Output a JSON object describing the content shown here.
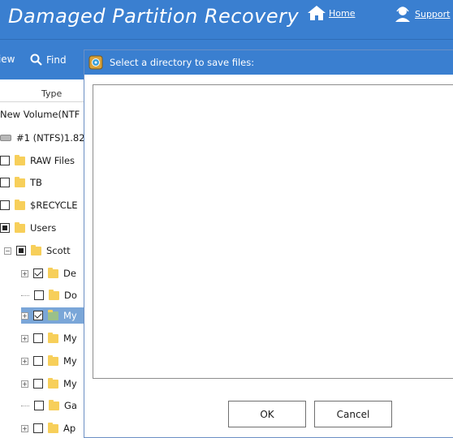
{
  "app": {
    "title": "Damaged Partition Recovery"
  },
  "nav": {
    "home_label": "Home",
    "support_label": "Support"
  },
  "toolbar": {
    "view_label": "View",
    "find_label": "Find"
  },
  "tree": {
    "column_header": "Type",
    "rows": [
      {
        "label": "New Volume(NTF"
      },
      {
        "label": "#1 (NTFS)1.82"
      },
      {
        "label": "RAW Files"
      },
      {
        "label": "TB"
      },
      {
        "label": "$RECYCLE"
      },
      {
        "label": "Users"
      },
      {
        "label": "Scott"
      },
      {
        "label": "De"
      },
      {
        "label": "Do"
      },
      {
        "label": "My"
      },
      {
        "label": "My"
      },
      {
        "label": "My"
      },
      {
        "label": "My"
      },
      {
        "label": "Ga"
      },
      {
        "label": "Ap"
      }
    ]
  },
  "dialog": {
    "title": "Select a directory to save files:",
    "ok_label": "OK",
    "cancel_label": "Cancel"
  },
  "colors": {
    "accent": "#3a7fd0",
    "selection": "#7aa6d8",
    "folder": "#f7cf5a"
  }
}
